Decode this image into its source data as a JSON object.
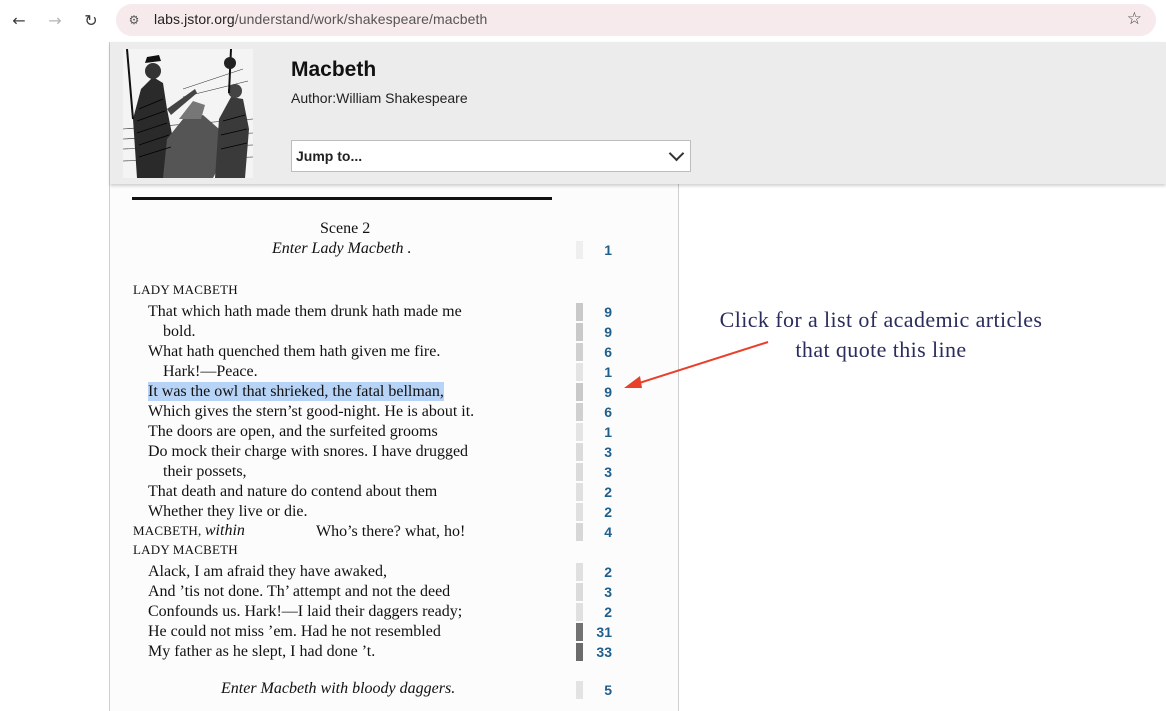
{
  "browser": {
    "url_host": "labs.jstor.org",
    "url_path": "/understand/work/shakespeare/macbeth",
    "back_icon": "←",
    "forward_icon": "→",
    "reload_icon": "↻",
    "site_settings_icon": "⚙",
    "star_icon": "☆"
  },
  "work": {
    "title": "Macbeth",
    "author": "Author:William Shakespeare"
  },
  "jump": {
    "label": "Jump to..."
  },
  "scene": {
    "heading": "Scene 2",
    "entry_stage": "Enter Lady Macbeth .",
    "exit_stage": "Enter Macbeth with bloody daggers."
  },
  "speakers": {
    "lady1": "LADY MACBETH",
    "macbeth": "MACBETH,",
    "macbeth_within": "within",
    "lady2": "LADY MACBETH"
  },
  "lines": [
    {
      "text": "That which hath made them drunk hath made me",
      "count": "9",
      "level": 0.25
    },
    {
      "text": "bold.",
      "count": "9",
      "level": 0.25
    },
    {
      "text": "What hath quenched them hath given me fire.",
      "count": "6",
      "level": 0.2
    },
    {
      "text": "Hark!—Peace.",
      "count": "1",
      "level": 0.05
    },
    {
      "text": "It was the owl that shrieked, the fatal bellman,",
      "count": "9",
      "level": 0.25
    },
    {
      "text": "Which gives the stern’st good-night. He is about it.",
      "count": "6",
      "level": 0.2
    },
    {
      "text": "The doors are open, and the surfeited grooms",
      "count": "1",
      "level": 0.05
    },
    {
      "text": "Do mock their charge with snores. I have drugged",
      "count": "3",
      "level": 0.12
    },
    {
      "text": "their possets,",
      "count": "3",
      "level": 0.12
    },
    {
      "text": "That death and nature do contend about them",
      "count": "2",
      "level": 0.08
    },
    {
      "text": "Whether they live or die.",
      "count": "2",
      "level": 0.08
    },
    {
      "text": "Who’s there? what, ho!",
      "count": "4",
      "level": 0.15
    },
    {
      "text": "Alack, I am afraid they have awaked,",
      "count": "2",
      "level": 0.08
    },
    {
      "text": "And ’tis not done. Th’ attempt and not the deed",
      "count": "3",
      "level": 0.12
    },
    {
      "text": "Confounds us. Hark!—I laid their daggers ready;",
      "count": "2",
      "level": 0.08
    },
    {
      "text": "He could not miss ’em. Had he not resembled",
      "count": "31",
      "level": 0.9
    },
    {
      "text": "My father as he slept, I had done ’t.",
      "count": "33",
      "level": 0.95
    }
  ],
  "entry_count": "1",
  "exit_count": "5",
  "annotation": {
    "line1": "Click for a list of academic articles",
    "line2": "that quote this line",
    "color": "#2a2d5c",
    "arrow_color": "#e8402a"
  }
}
